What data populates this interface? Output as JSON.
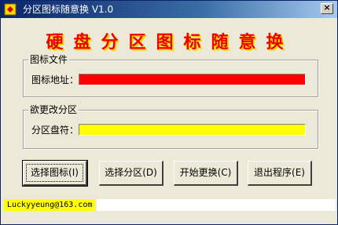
{
  "window": {
    "title": "分区图标随意换 V1.0",
    "close_symbol": "×",
    "icons": {
      "app": "app-icon",
      "close": "close-icon"
    }
  },
  "banner": {
    "text": "硬盘分区图标随意换"
  },
  "icon_group": {
    "label": "图标文件",
    "field_label": "图标地址：",
    "field_value": "",
    "field_color": "#ff0000"
  },
  "partition_group": {
    "label": "欲更改分区",
    "field_label": "分区盘符：",
    "field_value": "",
    "field_color": "#ffff00"
  },
  "buttons": {
    "select_icon": "选择图标(I)",
    "select_partition": "选择分区(D)",
    "start_change": "开始更换(C)",
    "exit": "退出程序(E)"
  },
  "status": {
    "email": "Luckyyeung@163.com"
  },
  "colors": {
    "titlebar_start": "#0a246a",
    "titlebar_end": "#a6caf0",
    "banner_text": "#ee0000",
    "banner_shadow": "#ffd800"
  }
}
